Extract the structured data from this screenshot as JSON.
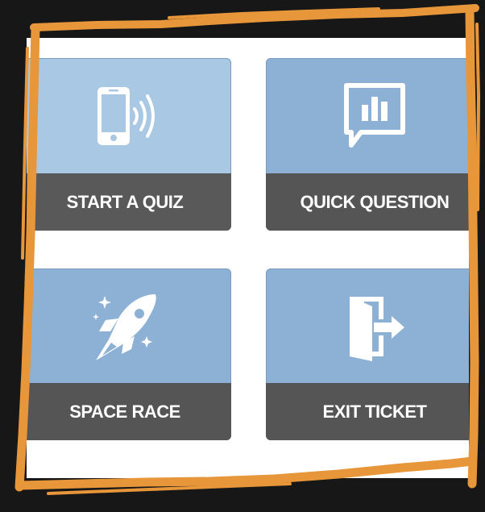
{
  "tiles": [
    {
      "label": "START A QUIZ",
      "icon": "phone-signal-icon"
    },
    {
      "label": "QUICK QUESTION",
      "icon": "chat-bar-chart-icon"
    },
    {
      "label": "SPACE RACE",
      "icon": "rocket-icon"
    },
    {
      "label": "EXIT TICKET",
      "icon": "exit-door-icon"
    }
  ],
  "colors": {
    "background": "#171717",
    "frame": "#e8963a",
    "tile_blue": "#8db1d4",
    "tile_light_blue": "#a9c8e3",
    "label_bar": "#555555",
    "panel": "#ffffff"
  }
}
